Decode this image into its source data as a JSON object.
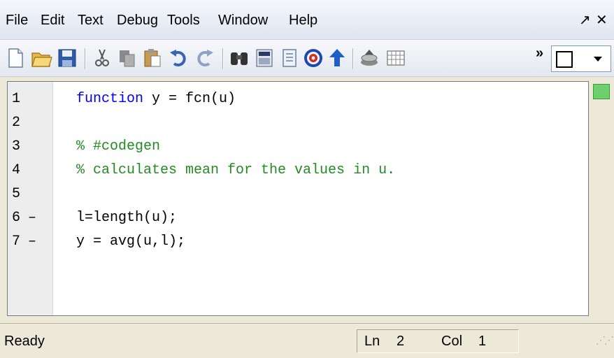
{
  "menu": {
    "items": [
      "File",
      "Edit",
      "Text",
      "Debug",
      "Tools",
      "Window",
      "Help"
    ],
    "undock_symbol": "↗",
    "close_symbol": "✕"
  },
  "toolbar": {
    "icons": [
      "new-file-icon",
      "open-folder-icon",
      "save-icon",
      "cut-icon",
      "copy-icon",
      "paste-icon",
      "undo-icon",
      "redo-icon",
      "find-binoculars-icon",
      "calculator-icon",
      "document-icon",
      "target-icon",
      "up-arrow-icon",
      "build-icon",
      "matrix-icon"
    ],
    "overflow_symbol": "»"
  },
  "editor": {
    "lines": [
      {
        "number": "1",
        "mark": "",
        "kind": "code",
        "text": "function y = fcn(u)"
      },
      {
        "number": "2",
        "mark": "",
        "kind": "blank",
        "text": ""
      },
      {
        "number": "3",
        "mark": "",
        "kind": "comment",
        "text": "% #codegen"
      },
      {
        "number": "4",
        "mark": "",
        "kind": "comment",
        "text": "% calculates mean for the values in u."
      },
      {
        "number": "5",
        "mark": "",
        "kind": "blank",
        "text": ""
      },
      {
        "number": "6",
        "mark": "–",
        "kind": "plain",
        "text": "l=length(u);"
      },
      {
        "number": "7",
        "mark": "–",
        "kind": "plain",
        "text": "y = avg(u,l);"
      }
    ],
    "line1_keyword": "function",
    "line1_rest": " y = fcn(u)",
    "status_color": "#6dd06d"
  },
  "status": {
    "state": "Ready",
    "ln_label": "Ln",
    "ln_value": "2",
    "col_label": "Col",
    "col_value": "1"
  }
}
